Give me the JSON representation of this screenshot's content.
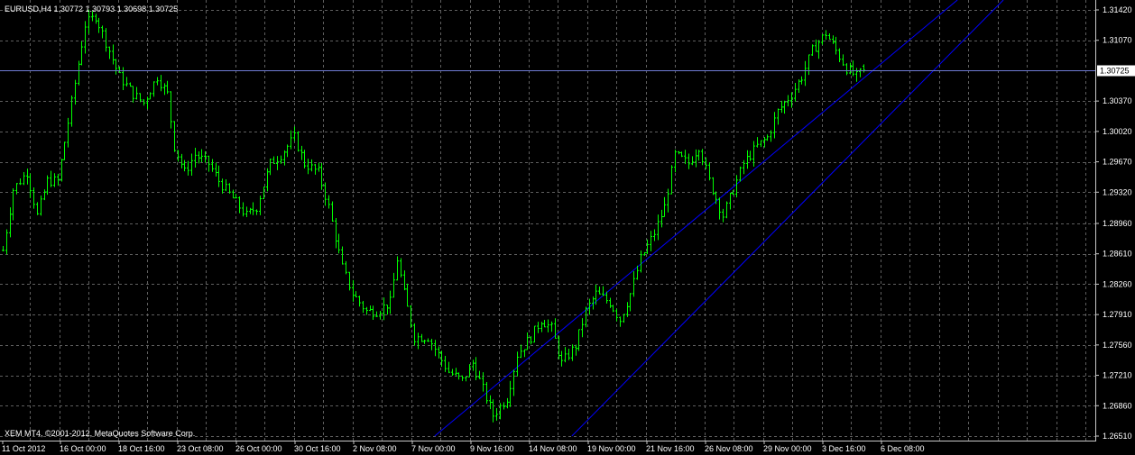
{
  "window": {
    "symbol_header": "EURUSD,H4  1.30772 1.30793 1.30698 1.30725",
    "copyright": "XEM MT4, ©2001-2012, MetaQuotes Software Corp."
  },
  "colors": {
    "background": "#000000",
    "grid": "#5f5f5f",
    "candle": "#00ff00",
    "price_line": "#6f7bd3",
    "channel": "#0000ff",
    "text": "#ffffff",
    "price_tag_bg": "#ffffff",
    "price_tag_text": "#000000"
  },
  "chart_data": {
    "type": "candlestick",
    "symbol": "EURUSD",
    "timeframe": "H4",
    "ohlc_last": {
      "open": 1.30772,
      "high": 1.30793,
      "low": 1.30698,
      "close": 1.30725
    },
    "current_price": 1.30725,
    "current_price_label": "1.30725",
    "ylim": [
      1.2651,
      1.3142
    ],
    "yticks": [
      1.3142,
      1.3107,
      1.3037,
      1.3002,
      1.2967,
      1.2932,
      1.2896,
      1.2861,
      1.2826,
      1.2791,
      1.2756,
      1.2721,
      1.2686,
      1.2651
    ],
    "ytick_labels": [
      "1.31420",
      "1.31070",
      "1.30370",
      "1.30020",
      "1.29670",
      "1.29320",
      "1.28960",
      "1.28610",
      "1.28260",
      "1.27910",
      "1.27560",
      "1.27210",
      "1.26860",
      "1.26510"
    ],
    "xtick_labels": [
      "11 Oct 2012",
      "16 Oct 00:00",
      "18 Oct 16:00",
      "23 Oct 08:00",
      "26 Oct 00:00",
      "30 Oct 16:00",
      "2 Nov 08:00",
      "7 Nov 00:00",
      "9 Nov 16:00",
      "14 Nov 08:00",
      "19 Nov 00:00",
      "21 Nov 16:00",
      "26 Nov 08:00",
      "29 Nov 00:00",
      "3 Dec 16:00",
      "6 Dec 08:00"
    ],
    "grid": true,
    "close_path": [
      {
        "bar": 0,
        "close": 1.2865
      },
      {
        "bar": 3,
        "close": 1.2935
      },
      {
        "bar": 7,
        "close": 1.2955
      },
      {
        "bar": 10,
        "close": 1.2905
      },
      {
        "bar": 13,
        "close": 1.2945
      },
      {
        "bar": 16,
        "close": 1.2945
      },
      {
        "bar": 20,
        "close": 1.3035
      },
      {
        "bar": 24,
        "close": 1.3125
      },
      {
        "bar": 27,
        "close": 1.3135
      },
      {
        "bar": 31,
        "close": 1.3095
      },
      {
        "bar": 34,
        "close": 1.3065
      },
      {
        "bar": 38,
        "close": 1.3045
      },
      {
        "bar": 41,
        "close": 1.3035
      },
      {
        "bar": 45,
        "close": 1.3065
      },
      {
        "bar": 48,
        "close": 1.3045
      },
      {
        "bar": 50,
        "close": 1.2985
      },
      {
        "bar": 53,
        "close": 1.2955
      },
      {
        "bar": 56,
        "close": 1.2975
      },
      {
        "bar": 60,
        "close": 1.2965
      },
      {
        "bar": 63,
        "close": 1.2945
      },
      {
        "bar": 67,
        "close": 1.2925
      },
      {
        "bar": 71,
        "close": 1.2905
      },
      {
        "bar": 74,
        "close": 1.2915
      },
      {
        "bar": 78,
        "close": 1.2965
      },
      {
        "bar": 81,
        "close": 1.2975
      },
      {
        "bar": 85,
        "close": 1.2995
      },
      {
        "bar": 88,
        "close": 1.2965
      },
      {
        "bar": 92,
        "close": 1.2955
      },
      {
        "bar": 95,
        "close": 1.2915
      },
      {
        "bar": 99,
        "close": 1.2845
      },
      {
        "bar": 102,
        "close": 1.2815
      },
      {
        "bar": 106,
        "close": 1.2795
      },
      {
        "bar": 109,
        "close": 1.2795
      },
      {
        "bar": 113,
        "close": 1.2805
      },
      {
        "bar": 115,
        "close": 1.2855
      },
      {
        "bar": 117,
        "close": 1.2815
      },
      {
        "bar": 120,
        "close": 1.2765
      },
      {
        "bar": 124,
        "close": 1.2765
      },
      {
        "bar": 127,
        "close": 1.2745
      },
      {
        "bar": 130,
        "close": 1.2725
      },
      {
        "bar": 134,
        "close": 1.2715
      },
      {
        "bar": 137,
        "close": 1.2735
      },
      {
        "bar": 140,
        "close": 1.2705
      },
      {
        "bar": 143,
        "close": 1.2675
      },
      {
        "bar": 147,
        "close": 1.2695
      },
      {
        "bar": 150,
        "close": 1.2745
      },
      {
        "bar": 154,
        "close": 1.2765
      },
      {
        "bar": 157,
        "close": 1.2785
      },
      {
        "bar": 160,
        "close": 1.2775
      },
      {
        "bar": 163,
        "close": 1.2735
      },
      {
        "bar": 167,
        "close": 1.2755
      },
      {
        "bar": 170,
        "close": 1.2795
      },
      {
        "bar": 173,
        "close": 1.2815
      },
      {
        "bar": 177,
        "close": 1.2805
      },
      {
        "bar": 180,
        "close": 1.2785
      },
      {
        "bar": 183,
        "close": 1.2815
      },
      {
        "bar": 186,
        "close": 1.2855
      },
      {
        "bar": 190,
        "close": 1.2885
      },
      {
        "bar": 193,
        "close": 1.2915
      },
      {
        "bar": 196,
        "close": 1.2975
      },
      {
        "bar": 200,
        "close": 1.2965
      },
      {
        "bar": 203,
        "close": 1.2985
      },
      {
        "bar": 206,
        "close": 1.2945
      },
      {
        "bar": 210,
        "close": 1.2905
      },
      {
        "bar": 213,
        "close": 1.2935
      },
      {
        "bar": 216,
        "close": 1.2965
      },
      {
        "bar": 220,
        "close": 1.2985
      },
      {
        "bar": 223,
        "close": 1.2995
      },
      {
        "bar": 226,
        "close": 1.3025
      },
      {
        "bar": 230,
        "close": 1.3045
      },
      {
        "bar": 233,
        "close": 1.3065
      },
      {
        "bar": 236,
        "close": 1.3095
      },
      {
        "bar": 240,
        "close": 1.3115
      },
      {
        "bar": 243,
        "close": 1.3095
      },
      {
        "bar": 246,
        "close": 1.3075
      },
      {
        "bar": 249,
        "close": 1.3065
      },
      {
        "bar": 251,
        "close": 1.30725
      }
    ],
    "trend_channel": {
      "lower": [
        {
          "bar": 153,
          "price": 1.2651
        },
        {
          "bar": 251,
          "price": 1.3018
        }
      ],
      "upper": [
        {
          "bar": 115,
          "price": 1.2651
        },
        {
          "bar": 251,
          "price": 1.3142
        }
      ],
      "parallel": [
        {
          "bar": 153,
          "price": 1.2651
        },
        {
          "bar": 251,
          "price": 1.3018
        }
      ]
    }
  }
}
